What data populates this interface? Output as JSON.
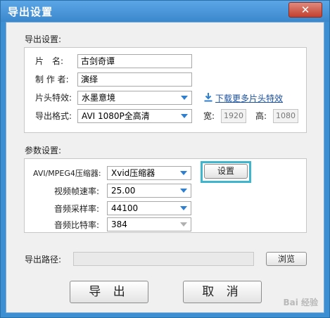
{
  "window": {
    "title": "导出设置",
    "close_symbol": "✕"
  },
  "export_section": {
    "label": "导出设置:",
    "title_label": "片　名:",
    "title_value": "古剑奇谭",
    "author_label": "制 作 者:",
    "author_value": "演绎",
    "intro_label": "片头特效:",
    "intro_value": "水墨意境",
    "download_link": "下载更多片头特效",
    "format_label": "导出格式:",
    "format_value": "AVI 1080P全高清",
    "width_label": "宽:",
    "width_value": "1920",
    "height_label": "高:",
    "height_value": "1080"
  },
  "params_section": {
    "label": "参数设置:",
    "compressor_label": "AVI/MPEG4压缩器:",
    "compressor_value": "Xvid压缩器",
    "settings_button": "设置",
    "framerate_label": "视频帧速率:",
    "framerate_value": "25.00",
    "samplerate_label": "音频采样率:",
    "samplerate_value": "44100",
    "bitrate_label": "音频比特率:",
    "bitrate_value": "384"
  },
  "path_section": {
    "label": "导出路径:",
    "value": "",
    "browse_button": "浏览"
  },
  "footer": {
    "export_button": "导 出",
    "cancel_button": "取 消",
    "watermark": "Bai 经验"
  },
  "colors": {
    "title_bar": "#3b88cc",
    "highlight": "#3fb6d0",
    "link": "#1a4f9c",
    "dropdown_arrow": "#2f7fd0",
    "close_button": "#c2402f"
  },
  "icons": {
    "close": "close-icon",
    "download": "download-icon",
    "dropdown": "chevron-down-icon"
  }
}
